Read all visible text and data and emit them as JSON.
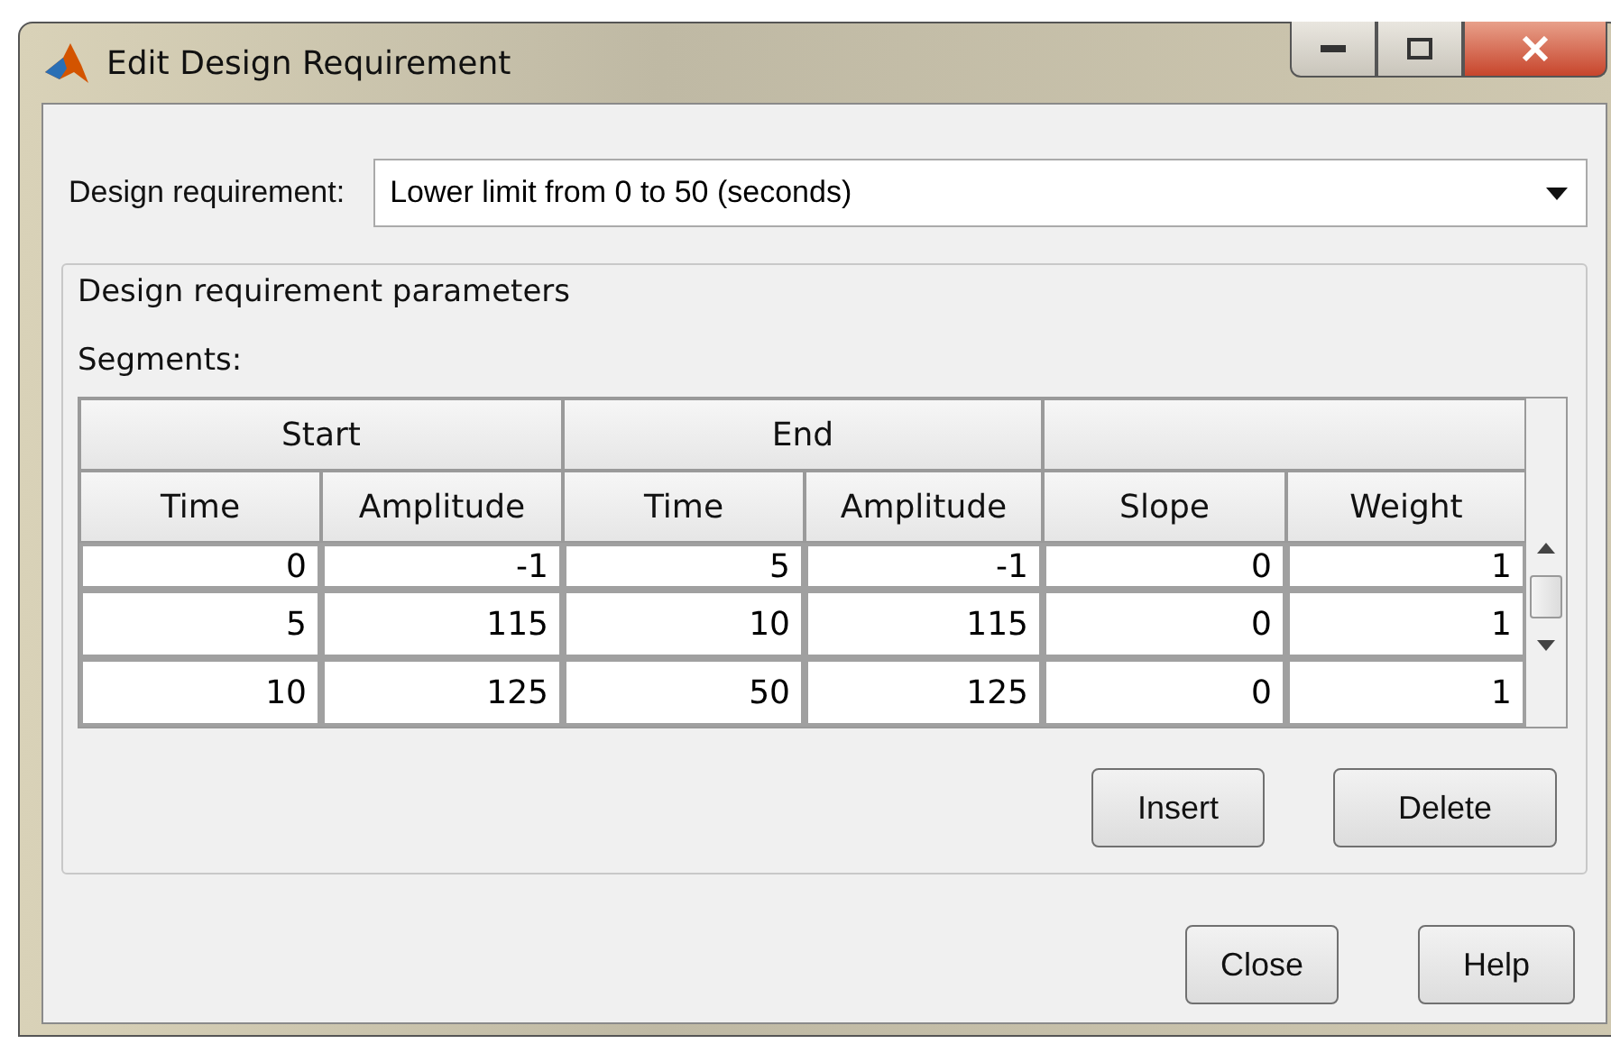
{
  "window": {
    "title": "Edit Design Requirement"
  },
  "design_requirement": {
    "label": "Design requirement:",
    "value": "Lower limit from 0 to 50 (seconds)"
  },
  "parameters_group": {
    "title": "Design requirement parameters",
    "segments_label": "Segments:"
  },
  "table": {
    "groups": [
      {
        "kind": "titled",
        "label": "Start"
      },
      {
        "kind": "titled",
        "label": "End"
      },
      {
        "kind": "blank"
      }
    ],
    "columns": [
      "Time",
      "Amplitude",
      "Time",
      "Amplitude",
      "Slope",
      "Weight"
    ],
    "rows": [
      [
        "0",
        "-1",
        "5",
        "-1",
        "0",
        "1"
      ],
      [
        "5",
        "115",
        "10",
        "115",
        "0",
        "1"
      ],
      [
        "10",
        "125",
        "50",
        "125",
        "0",
        "1"
      ]
    ]
  },
  "table_buttons": [
    "Insert",
    "Delete"
  ],
  "dialog_buttons": [
    "Close",
    "Help"
  ]
}
